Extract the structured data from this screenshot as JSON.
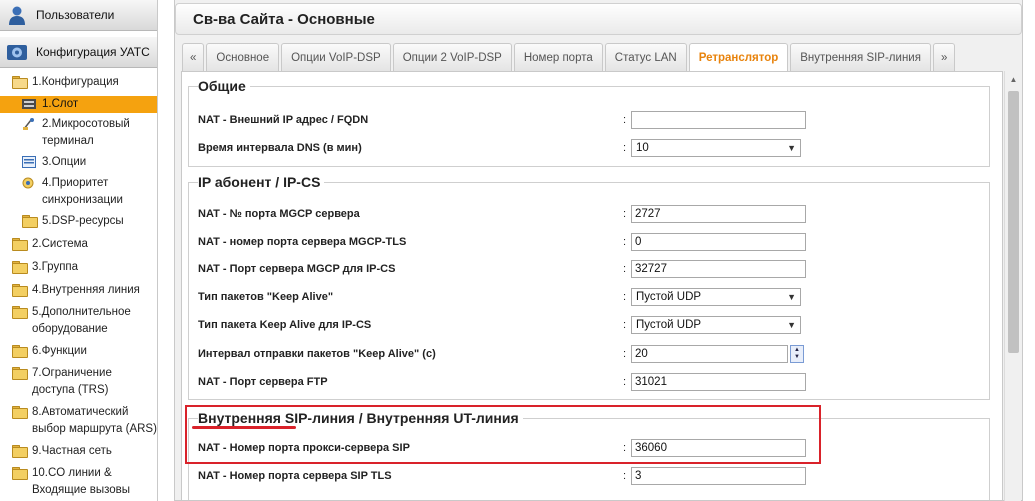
{
  "sidebar": {
    "header_users": "Пользователи",
    "header_config": "Конфигурация УАТС",
    "tree": [
      {
        "label": "1.Конфигурация",
        "icon": "folder-open-icon"
      },
      {
        "label": "1.Слот",
        "icon": "slot-icon",
        "selected": true
      },
      {
        "label": "2.Микросотовый терминал",
        "icon": "antenna-icon"
      },
      {
        "label": "3.Опции",
        "icon": "options-icon"
      },
      {
        "label": "4.Приоритет синхронизации",
        "icon": "sync-icon"
      },
      {
        "label": "5.DSP-ресурсы",
        "icon": "folder-icon"
      },
      {
        "label": "2.Система",
        "icon": "folder-icon"
      },
      {
        "label": "3.Группа",
        "icon": "folder-icon"
      },
      {
        "label": "4.Внутренняя линия",
        "icon": "folder-icon"
      },
      {
        "label": "5.Дополнительное оборудование",
        "icon": "folder-icon"
      },
      {
        "label": "6.Функции",
        "icon": "folder-icon"
      },
      {
        "label": "7.Ограничение доступа (TRS)",
        "icon": "folder-icon"
      },
      {
        "label": "8.Автоматический выбор маршрута (ARS)",
        "icon": "folder-icon"
      },
      {
        "label": "9.Частная сеть",
        "icon": "folder-icon"
      },
      {
        "label": "10.CO линии & Входящие вызовы",
        "icon": "folder-icon"
      }
    ]
  },
  "main": {
    "title": "Св-ва Сайта - Основные",
    "tabs": [
      {
        "label": "«",
        "arrow": true
      },
      {
        "label": "Основное"
      },
      {
        "label": "Опции VoIP-DSP"
      },
      {
        "label": "Опции 2 VoIP-DSP"
      },
      {
        "label": "Номер порта"
      },
      {
        "label": "Статус LAN"
      },
      {
        "label": "Ретранслятор",
        "active": true
      },
      {
        "label": "Внутренняя SIP-линия"
      },
      {
        "label": "»",
        "arrow": true
      }
    ],
    "groups": {
      "general": {
        "title": "Общие",
        "rows": {
          "external_ip": {
            "label": "NAT - Внешний IP адрес / FQDN",
            "value": ""
          },
          "dns_interval": {
            "label": "Время интервала DNS (в мин)",
            "value": "10"
          }
        }
      },
      "ipcs": {
        "title": "IP абонент / IP-CS",
        "rows": {
          "mgcp_port": {
            "label": "NAT - № порта MGCP сервера",
            "value": "2727"
          },
          "mgcp_tls_port": {
            "label": "NAT - номер порта сервера MGCP-TLS",
            "value": "0"
          },
          "mgcp_ipcs_port": {
            "label": "NAT - Порт сервера MGCP для IP-CS",
            "value": "32727"
          },
          "keepalive_type": {
            "label": "Тип пакетов \"Keep Alive\"",
            "value": "Пустой UDP"
          },
          "keepalive_ipcs": {
            "label": "Тип пакета Keep Alive для IP-CS",
            "value": "Пустой UDP"
          },
          "keepalive_interval": {
            "label": "Интервал отправки пакетов \"Keep Alive\" (с)",
            "value": "20"
          },
          "ftp_port": {
            "label": "NAT - Порт сервера FTP",
            "value": "31021"
          }
        }
      },
      "sip": {
        "title": "Внутренняя SIP-линия / Внутренняя UT-линия",
        "rows": {
          "sip_proxy_port": {
            "label": "NAT - Номер порта прокси-сервера SIP",
            "value": "36060"
          },
          "sip_tls_port": {
            "label": "NAT - Номер порта сервера SIP TLS",
            "value": "3"
          }
        }
      }
    },
    "colon": ":"
  },
  "colors": {
    "accent": "#f5a20f",
    "active_tab": "#e8830c",
    "highlight": "#d9222a"
  }
}
